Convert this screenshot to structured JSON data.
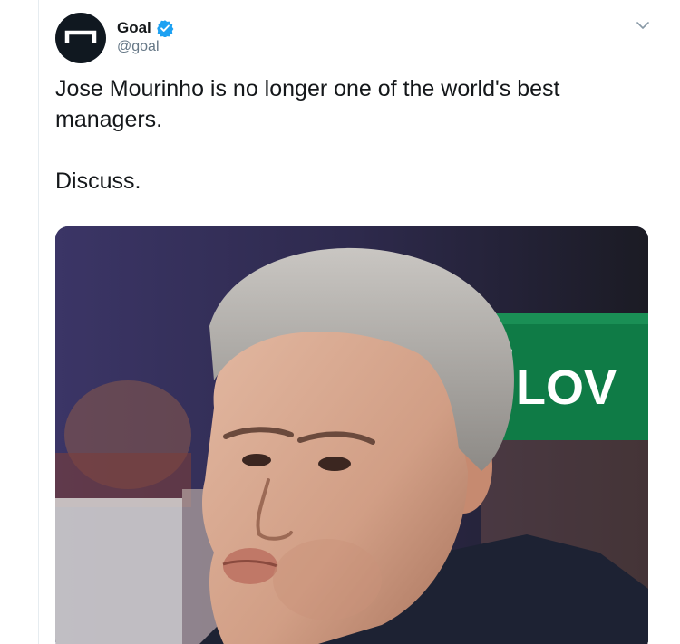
{
  "tweet": {
    "author": {
      "display_name": "Goal",
      "handle": "@goal",
      "verified": true,
      "avatar_icon": "goal-logo-icon"
    },
    "menu_icon": "chevron-down-icon",
    "text_lines": [
      "Jose Mourinho is no longer one of the world's best managers.",
      "Discuss."
    ],
    "media": {
      "type": "photo",
      "background_sign_text": "LOV"
    }
  },
  "colors": {
    "verified_blue": "#1da1f2",
    "sign_green": "#0f7b46",
    "avatar_bg": "#101820"
  }
}
